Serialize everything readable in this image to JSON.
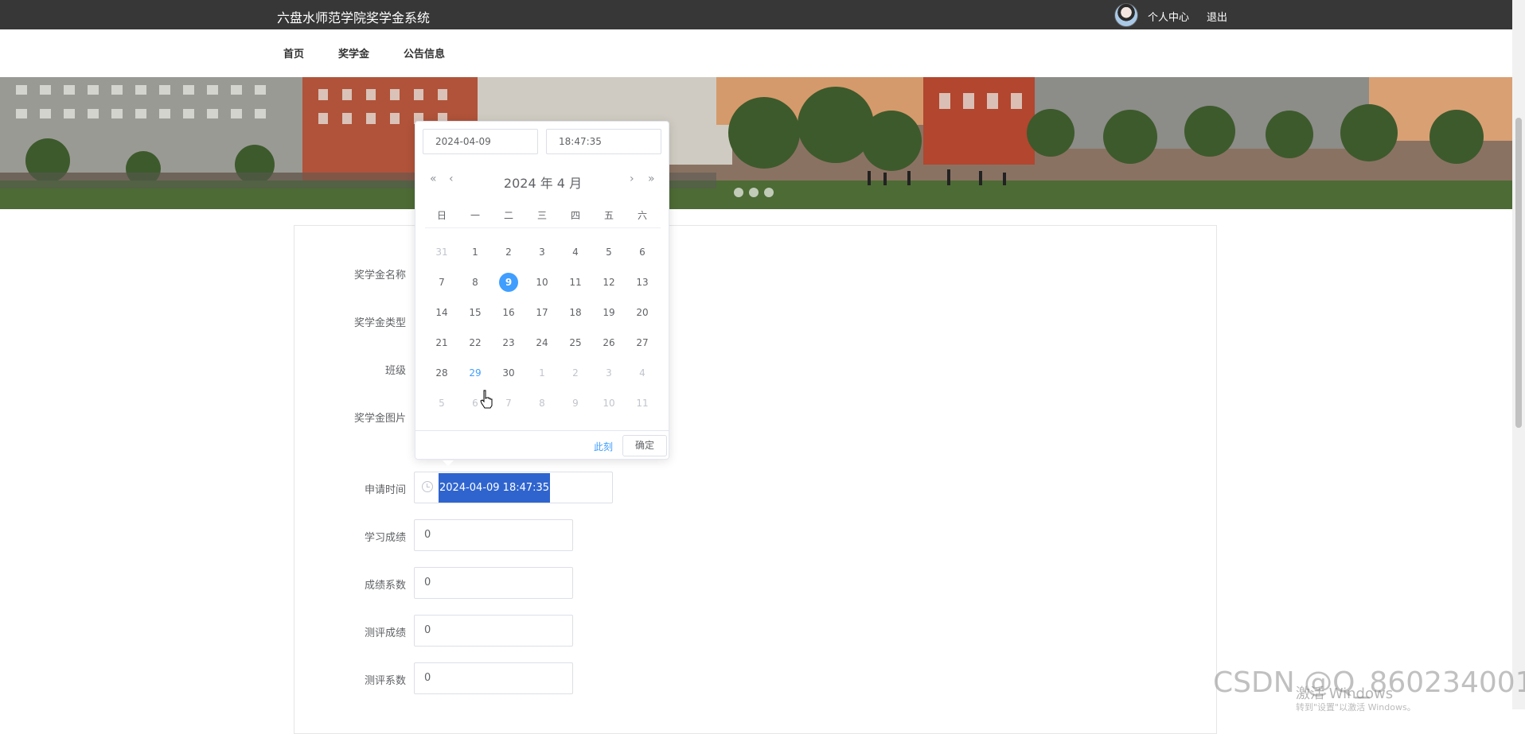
{
  "header": {
    "site_title": "六盘水师范学院奖学金系统",
    "personal_center": "个人中心",
    "logout": "退出"
  },
  "nav": {
    "items": [
      {
        "label": "首页"
      },
      {
        "label": "奖学金"
      },
      {
        "label": "公告信息"
      }
    ]
  },
  "banner": {
    "slide_count": 3
  },
  "form": {
    "fields": [
      {
        "label": "奖学金名称"
      },
      {
        "label": "奖学金类型"
      },
      {
        "label": "班级"
      },
      {
        "label": "奖学金图片"
      },
      {
        "label": "申请时间",
        "value": "2024-04-09 18:47:35"
      },
      {
        "label": "学习成绩",
        "value": "0"
      },
      {
        "label": "成绩系数",
        "value": "0"
      },
      {
        "label": "测评成绩",
        "value": "0"
      },
      {
        "label": "测评系数",
        "value": "0"
      }
    ]
  },
  "date_picker": {
    "date_input": "2024-04-09",
    "time_input": "18:47:35",
    "header_title": "2024 年  4 月",
    "weekdays": [
      "日",
      "一",
      "二",
      "三",
      "四",
      "五",
      "六"
    ],
    "weeks": [
      [
        {
          "d": "31",
          "t": "prev"
        },
        {
          "d": "1"
        },
        {
          "d": "2"
        },
        {
          "d": "3"
        },
        {
          "d": "4"
        },
        {
          "d": "5"
        },
        {
          "d": "6"
        }
      ],
      [
        {
          "d": "7"
        },
        {
          "d": "8"
        },
        {
          "d": "9",
          "t": "selected"
        },
        {
          "d": "10"
        },
        {
          "d": "11"
        },
        {
          "d": "12"
        },
        {
          "d": "13"
        }
      ],
      [
        {
          "d": "14"
        },
        {
          "d": "15"
        },
        {
          "d": "16"
        },
        {
          "d": "17"
        },
        {
          "d": "18"
        },
        {
          "d": "19"
        },
        {
          "d": "20"
        }
      ],
      [
        {
          "d": "21"
        },
        {
          "d": "22"
        },
        {
          "d": "23"
        },
        {
          "d": "24"
        },
        {
          "d": "25"
        },
        {
          "d": "26"
        },
        {
          "d": "27"
        }
      ],
      [
        {
          "d": "28"
        },
        {
          "d": "29",
          "t": "today"
        },
        {
          "d": "30"
        },
        {
          "d": "1",
          "t": "next"
        },
        {
          "d": "2",
          "t": "next"
        },
        {
          "d": "3",
          "t": "next"
        },
        {
          "d": "4",
          "t": "next"
        }
      ],
      [
        {
          "d": "5",
          "t": "next"
        },
        {
          "d": "6",
          "t": "next"
        },
        {
          "d": "7",
          "t": "next"
        },
        {
          "d": "8",
          "t": "next"
        },
        {
          "d": "9",
          "t": "next"
        },
        {
          "d": "10",
          "t": "next"
        },
        {
          "d": "11",
          "t": "next"
        }
      ]
    ],
    "now_label": "此刻",
    "confirm_label": "确定",
    "icons": {
      "prev_year": "double-chevron-left-icon",
      "prev_month": "chevron-left-icon",
      "next_month": "chevron-right-icon",
      "next_year": "double-chevron-right-icon"
    },
    "selected_color": "#409eff"
  },
  "watermark": {
    "csdn": "CSDN @Q_860234001",
    "windows_line1": "激活 Windows",
    "windows_line2": "转到\"设置\"以激活 Windows。"
  }
}
